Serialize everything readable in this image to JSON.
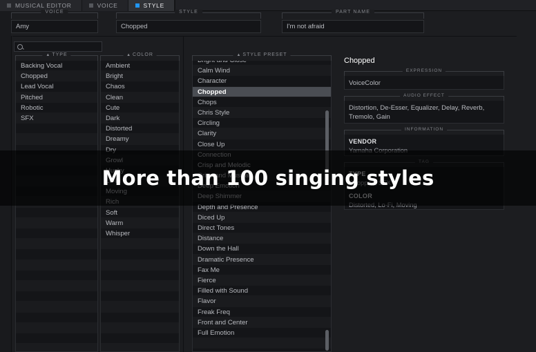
{
  "tabs": [
    {
      "label": "MUSICAL EDITOR",
      "active": false
    },
    {
      "label": "VOICE",
      "active": false
    },
    {
      "label": "STYLE",
      "active": true
    }
  ],
  "header_fields": [
    {
      "legend": "VOICE",
      "value": "Amy"
    },
    {
      "legend": "STYLE",
      "value": "Chopped"
    },
    {
      "legend": "PART NAME",
      "value": "I'm not afraid"
    }
  ],
  "search": {
    "value": "",
    "placeholder": ""
  },
  "columns": [
    {
      "legend": "TYPE",
      "items": [
        "Backing Vocal",
        "Chopped",
        "Lead Vocal",
        "Pitched",
        "Robotic",
        "SFX"
      ]
    },
    {
      "legend": "COLOR",
      "items": [
        "Ambient",
        "Bright",
        "Chaos",
        "Clean",
        "Cute",
        "Dark",
        "Distorted",
        "Dreamy",
        "Dry",
        "Growl",
        "Husky",
        "Lo-Fi",
        "Moving",
        "Rich",
        "Soft",
        "Warm",
        "Whisper"
      ]
    }
  ],
  "style_preset": {
    "legend": "STYLE PRESET",
    "selected": "Chopped",
    "items": [
      "Bright and Close",
      "Calm Wind",
      "Character",
      "Chopped",
      "Chops",
      "Chris Style",
      "Circling",
      "Clarity",
      "Close Up",
      "Connection",
      "Crisp and Melodic",
      "Crisp and Musical",
      "Deep Emotion",
      "Deep Shimmer",
      "Depth and Presence",
      "Diced Up",
      "Direct Tones",
      "Distance",
      "Down the Hall",
      "Dramatic Presence",
      "Fax Me",
      "Fierce",
      "Filled with Sound",
      "Flavor",
      "Freak Freq",
      "Front and Center",
      "Full Emotion"
    ]
  },
  "detail": {
    "title": "Chopped",
    "expression": {
      "legend": "EXPRESSION",
      "value": "VoiceColor"
    },
    "audio_effect": {
      "legend": "AUDIO EFFECT",
      "value": "Distortion, De-Esser, Equalizer, Delay, Reverb, Tremolo, Gain"
    },
    "information": {
      "legend": "INFORMATION",
      "vendor_key": "VENDOR",
      "vendor_value": "Yamaha Corporation"
    },
    "tag": {
      "legend": "TAG",
      "type_key": "TYPE",
      "type_value": "Chopped, SFX",
      "color_key": "COLOR",
      "color_value": "Distorted, Lo-Fi, Moving"
    }
  },
  "banner": {
    "text": "More than 100 singing styles"
  },
  "colors": {
    "accent": "#2196f3",
    "background": "#1c1d20",
    "list_bg": "#141518",
    "selection": "#4a4d53"
  }
}
